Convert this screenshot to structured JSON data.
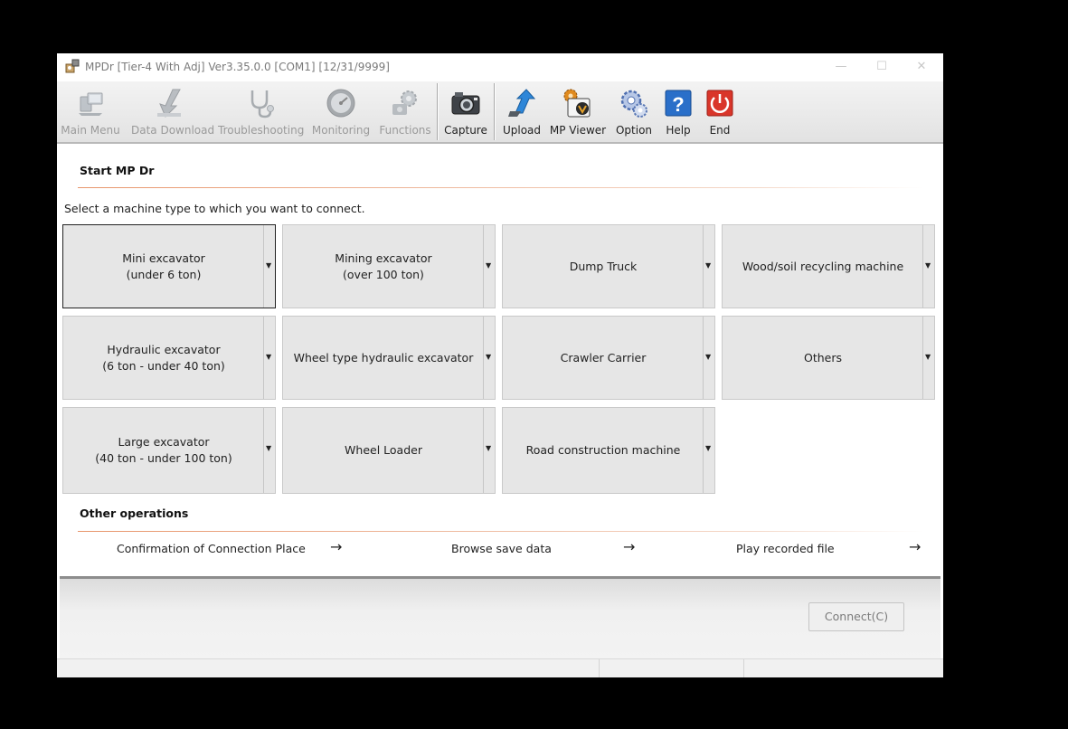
{
  "window": {
    "title": "MPDr [Tier-4 With Adj] Ver3.35.0.0 [COM1] [12/31/9999]",
    "controls": {
      "minimize": "—",
      "maximize": "☐",
      "close": "✕"
    }
  },
  "toolbar": {
    "items": [
      {
        "label": "Main Menu",
        "icon": "computer-icon",
        "enabled": false
      },
      {
        "label": "Data Download",
        "icon": "download-arrow-icon",
        "enabled": false
      },
      {
        "label": "Troubleshooting",
        "icon": "stethoscope-icon",
        "enabled": false
      },
      {
        "label": "Monitoring",
        "icon": "gauge-icon",
        "enabled": false
      },
      {
        "label": "Functions",
        "icon": "gears-icon",
        "enabled": false
      },
      {
        "label": "Capture",
        "icon": "camera-icon",
        "enabled": true
      },
      {
        "label": "Upload",
        "icon": "upload-arrow-icon",
        "enabled": true
      },
      {
        "label": "MP Viewer",
        "icon": "mp-viewer-icon",
        "enabled": true
      },
      {
        "label": "Option",
        "icon": "option-gears-icon",
        "enabled": true
      },
      {
        "label": "Help",
        "icon": "help-icon",
        "enabled": true
      },
      {
        "label": "End",
        "icon": "power-icon",
        "enabled": true
      }
    ]
  },
  "main": {
    "heading": "Start MP Dr",
    "instruction": "Select a machine type to which you want to connect.",
    "machines": [
      {
        "label": "Mini excavator\n(under 6 ton)",
        "selected": true
      },
      {
        "label": "Mining excavator\n(over 100 ton)",
        "selected": false
      },
      {
        "label": "Dump Truck",
        "selected": false
      },
      {
        "label": "Wood/soil recycling machine",
        "selected": false
      },
      {
        "label": "Hydraulic excavator\n(6 ton - under 40 ton)",
        "selected": false
      },
      {
        "label": "Wheel type hydraulic excavator",
        "selected": false
      },
      {
        "label": "Crawler Carrier",
        "selected": false
      },
      {
        "label": "Others",
        "selected": false
      },
      {
        "label": "Large excavator\n(40 ton - under 100 ton)",
        "selected": false
      },
      {
        "label": "Wheel Loader",
        "selected": false
      },
      {
        "label": "Road construction machine",
        "selected": false
      }
    ],
    "dropdown_glyph": "▼"
  },
  "other_operations": {
    "heading": "Other operations",
    "links": [
      {
        "label": "Confirmation of Connection Place",
        "arrow": "→"
      },
      {
        "label": "Browse save data",
        "arrow": "→"
      },
      {
        "label": "Play recorded file",
        "arrow": "→"
      }
    ]
  },
  "footer": {
    "connect_label": "Connect(C)",
    "connect_enabled": false
  },
  "colors": {
    "accent_rule": "#e8956b",
    "help_blue": "#2a6fc9",
    "end_red": "#d9352a"
  }
}
